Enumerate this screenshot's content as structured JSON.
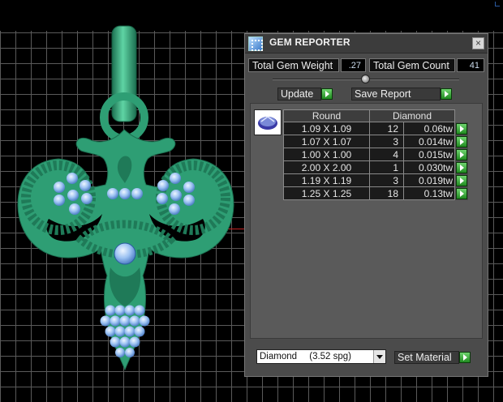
{
  "panel": {
    "title": "GEM REPORTER",
    "close_symbol": "×",
    "icon": "gem-reporter-app-icon"
  },
  "stats": {
    "weight_label": "Total Gem Weight",
    "weight_value": ".27",
    "count_label": "Total Gem Count",
    "count_value": "41"
  },
  "actions": {
    "update_label": "Update",
    "save_label": "Save Report"
  },
  "table": {
    "col_shape": "Round",
    "col_material": "Diamond",
    "rows": [
      {
        "size": "1.09 X 1.09",
        "count": "12",
        "weight": "0.06tw"
      },
      {
        "size": "1.07 X 1.07",
        "count": "3",
        "weight": "0.014tw"
      },
      {
        "size": "1.00 X 1.00",
        "count": "4",
        "weight": "0.015tw"
      },
      {
        "size": "2.00 X 2.00",
        "count": "1",
        "weight": "0.030tw"
      },
      {
        "size": "1.19 X 1.19",
        "count": "3",
        "weight": "0.019tw"
      },
      {
        "size": "1.25 X 1.25",
        "count": "18",
        "weight": "0.13tw"
      }
    ]
  },
  "material": {
    "selected_name": "Diamond",
    "selected_spg": "(3.52 spg)",
    "set_label": "Set Material"
  },
  "colors": {
    "metal": "#2e9e74",
    "gem": "#8fb8f0",
    "panel_bg": "#4b4b4b",
    "go_green": "#2fa52f"
  }
}
